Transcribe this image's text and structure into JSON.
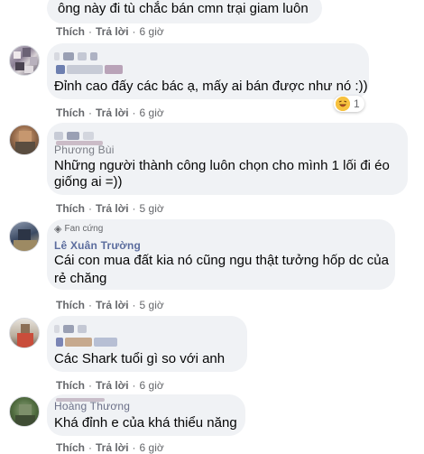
{
  "comments": [
    {
      "text_lines": [
        "ông này đi tù chắc bán cmn trại giam luôn"
      ],
      "actions": {
        "like": "Thích",
        "reply": "Trả lời",
        "time": "6 giờ"
      }
    },
    {
      "author": "",
      "text_lines": [
        "Đỉnh cao đấy các bác ạ, mấy ai bán được như nó :))"
      ],
      "actions": {
        "like": "Thích",
        "reply": "Trả lời",
        "time": "6 giờ"
      },
      "reaction": {
        "icon": "haha-emoji-icon",
        "count": "1"
      }
    },
    {
      "author": "Phương Bùi",
      "text_lines": [
        "Những người thành công luôn chọn cho mình 1 lối đi éo",
        "giống ai =))"
      ],
      "actions": {
        "like": "Thích",
        "reply": "Trả lời",
        "time": "5 giờ"
      }
    },
    {
      "badge": "Fan cứng",
      "author": "Lê Xuân Trường",
      "text_lines": [
        "Cái con mua đất kia nó cũng ngu thật tưởng hốp dc của",
        "rẻ chăng"
      ],
      "actions": {
        "like": "Thích",
        "reply": "Trả lời",
        "time": "5 giờ"
      }
    },
    {
      "author": "",
      "text_lines": [
        "Các Shark tuổi gì so với anh"
      ],
      "actions": {
        "like": "Thích",
        "reply": "Trả lời",
        "time": "6 giờ"
      }
    },
    {
      "author": "Hoàng Thương",
      "text_lines": [
        "Khá đỉnh e của khá thiểu năng"
      ],
      "actions": {
        "like": "Thích",
        "reply": "Trả lời",
        "time": "6 giờ"
      }
    }
  ],
  "colors": {
    "bubble": "#f0f2f5",
    "meta_text": "#65676b",
    "text": "#050505"
  }
}
